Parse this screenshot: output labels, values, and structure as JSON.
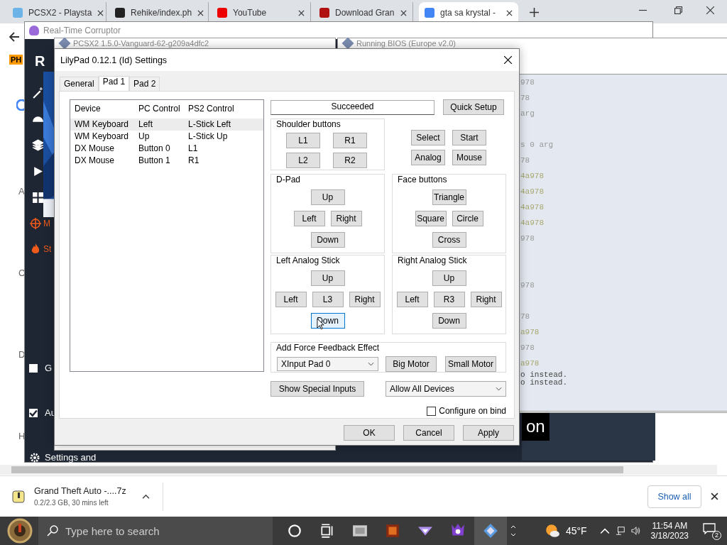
{
  "browser": {
    "tabs": [
      {
        "title": "PCSX2 - Playsta",
        "selected": false,
        "kind": "logo"
      },
      {
        "title": "Rehike/index.ph",
        "selected": false,
        "kind": "github"
      },
      {
        "title": "YouTube",
        "selected": false,
        "kind": "play"
      },
      {
        "title": "Download Gran",
        "selected": false,
        "kind": "v"
      },
      {
        "title": "gta sa krystal -",
        "selected": true,
        "kind": "g"
      }
    ],
    "bookmark": "PH",
    "page_fragments": [
      "A",
      "C",
      "D",
      "H"
    ]
  },
  "corruptor": {
    "title": "Real-Time Corruptor",
    "logo": "R",
    "nav": [
      {
        "label": "M",
        "kind": "crosshair"
      },
      {
        "label": "St",
        "kind": "flame"
      }
    ],
    "checkboxes": [
      {
        "label": "G",
        "checked": false
      },
      {
        "label": "Au",
        "checked": true
      }
    ],
    "settings": "Settings and",
    "banner": "on"
  },
  "emulator": {
    "title": "PCSX2 1.5.0-Vanguard-62-g209a4dfc2"
  },
  "bios": {
    "title": "Running BIOS (Europe v2.0)",
    "log": [
      {
        "text": "978",
        "kind": "info"
      },
      {
        "text": "78",
        "kind": "info"
      },
      {
        "text": "arg",
        "kind": "info"
      },
      {
        "kind": "gap"
      },
      {
        "text": "s 0 arg",
        "kind": "info"
      },
      {
        "text": "78",
        "kind": "info"
      },
      {
        "text": "4a978",
        "kind": "warn"
      },
      {
        "text": "4a978",
        "kind": "warn"
      },
      {
        "text": "4a978",
        "kind": "warn"
      },
      {
        "text": "4a978",
        "kind": "warn"
      },
      {
        "text": "978",
        "kind": "info"
      },
      {
        "kind": "gap"
      },
      {
        "kind": "gap"
      },
      {
        "text": "978",
        "kind": "info"
      },
      {
        "kind": "gap"
      },
      {
        "text": "78",
        "kind": "info"
      },
      {
        "text": "a978",
        "kind": "warn"
      },
      {
        "text": "978",
        "kind": "info"
      },
      {
        "text": "a978",
        "kind": "warn"
      }
    ],
    "messages": [
      "o instead.",
      "o instead."
    ]
  },
  "dialog": {
    "title": "LilyPad 0.12.1 (Id) Settings",
    "tabs": [
      {
        "label": "General",
        "selected": false
      },
      {
        "label": "Pad 1",
        "selected": true
      },
      {
        "label": "Pad 2",
        "selected": false
      }
    ],
    "columns": [
      "Device",
      "PC Control",
      "PS2 Control"
    ],
    "rows": [
      {
        "cells": [
          "WM Keyboard",
          "Left",
          "L-Stick Left"
        ],
        "selected": true
      },
      {
        "cells": [
          "WM Keyboard",
          "Up",
          "L-Stick Up"
        ],
        "selected": false
      },
      {
        "cells": [
          "DX Mouse",
          "Button 0",
          "L1"
        ],
        "selected": false
      },
      {
        "cells": [
          "DX Mouse",
          "Button 1",
          "R1"
        ],
        "selected": false
      }
    ],
    "status": "Succeeded",
    "quick_setup": "Quick Setup",
    "shoulder": {
      "title": "Shoulder buttons",
      "rows": [
        [
          {
            "label": "L1",
            "highlighted": false
          },
          {
            "label": "R1",
            "highlighted": false
          }
        ],
        [
          {
            "label": "L2",
            "highlighted": false
          },
          {
            "label": "R2",
            "highlighted": false
          }
        ]
      ]
    },
    "extra": {
      "rows": [
        [
          {
            "label": "Select",
            "highlighted": false
          },
          {
            "label": "Start",
            "highlighted": false
          }
        ],
        [
          {
            "label": "Analog",
            "highlighted": false
          },
          {
            "label": "Mouse",
            "highlighted": false
          }
        ]
      ]
    },
    "groups": [
      {
        "title": "D-Pad",
        "rows": [
          [
            {
              "label": "Up",
              "highlighted": false
            }
          ],
          [
            {
              "label": "Left",
              "highlighted": false
            },
            {
              "label": "Right",
              "highlighted": false
            }
          ],
          [
            {
              "label": "Down",
              "highlighted": false
            }
          ]
        ]
      },
      {
        "title": "Face buttons",
        "rows": [
          [
            {
              "label": "Triangle",
              "highlighted": false
            }
          ],
          [
            {
              "label": "Square",
              "highlighted": false
            },
            {
              "label": "Circle",
              "highlighted": false
            }
          ],
          [
            {
              "label": "Cross",
              "highlighted": false
            }
          ]
        ]
      },
      {
        "title": "Left Analog Stick",
        "rows": [
          [
            {
              "label": "Up",
              "highlighted": false
            }
          ],
          [
            {
              "label": "Left",
              "highlighted": false
            },
            {
              "label": "L3",
              "highlighted": false
            },
            {
              "label": "Right",
              "highlighted": false
            }
          ],
          [
            {
              "label": "Down",
              "highlighted": true
            }
          ]
        ]
      },
      {
        "title": "Right Analog Stick",
        "rows": [
          [
            {
              "label": "Up",
              "highlighted": false
            }
          ],
          [
            {
              "label": "Left",
              "highlighted": false
            },
            {
              "label": "R3",
              "highlighted": false
            },
            {
              "label": "Right",
              "highlighted": false
            }
          ],
          [
            {
              "label": "Down",
              "highlighted": false
            }
          ]
        ]
      }
    ],
    "force": {
      "title": "Add Force Feedback Effect",
      "device": "XInput Pad 0",
      "buttons": [
        "Big Motor",
        "Small Motor"
      ]
    },
    "special": "Show Special Inputs",
    "devices": "Allow All Devices",
    "configure": {
      "label": "Configure on bind",
      "checked": false
    },
    "actions": [
      "OK",
      "Cancel",
      "Apply"
    ]
  },
  "downloads": {
    "file": "Grand Theft Auto -....7z",
    "progress": "0.2/2.3 GB, 30 mins left",
    "show_all": "Show all"
  },
  "taskbar": {
    "search": "Type here to search",
    "temperature": "45°F",
    "time": "11:54 AM",
    "date": "3/18/2023",
    "notifications": "2"
  }
}
